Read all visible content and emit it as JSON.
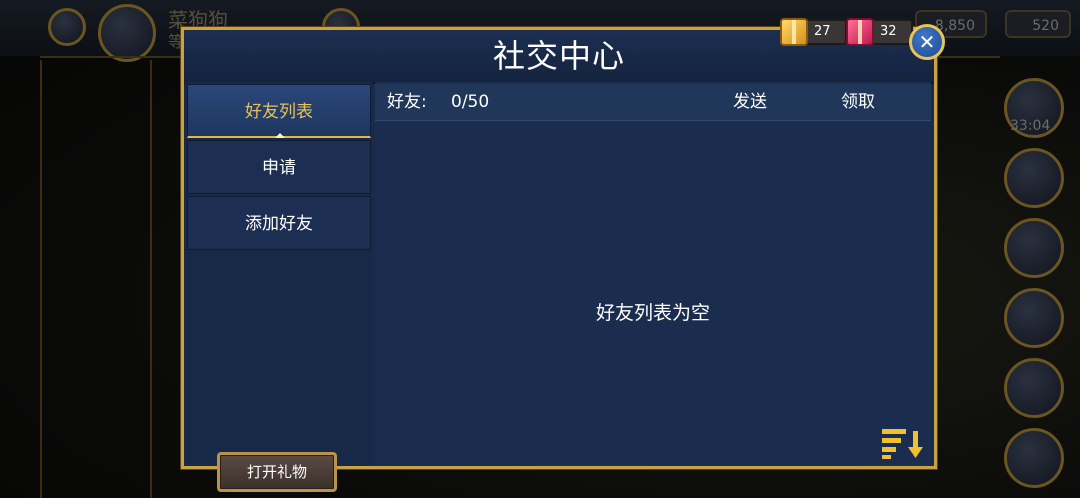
{
  "background": {
    "player_name": "菜狗狗",
    "player_level_fragment": "等",
    "coins": "8,850",
    "gems": "520",
    "timer": "33:04"
  },
  "modal": {
    "title": "社交中心",
    "gift_gold_count": "27",
    "gift_pink_count": "32",
    "close_icon": "close-icon"
  },
  "tabs": [
    {
      "label": "好友列表",
      "active": true
    },
    {
      "label": "申请",
      "active": false
    },
    {
      "label": "添加好友",
      "active": false
    }
  ],
  "open_gift_label": "打开礼物",
  "list_header": {
    "label": "好友:",
    "count": "0/50",
    "send": "发送",
    "claim": "领取"
  },
  "empty_message": "好友列表为空",
  "colors": {
    "accent_gold": "#c9a243",
    "panel_blue": "#1b2d4e",
    "active_tab_text": "#e8c25a"
  }
}
